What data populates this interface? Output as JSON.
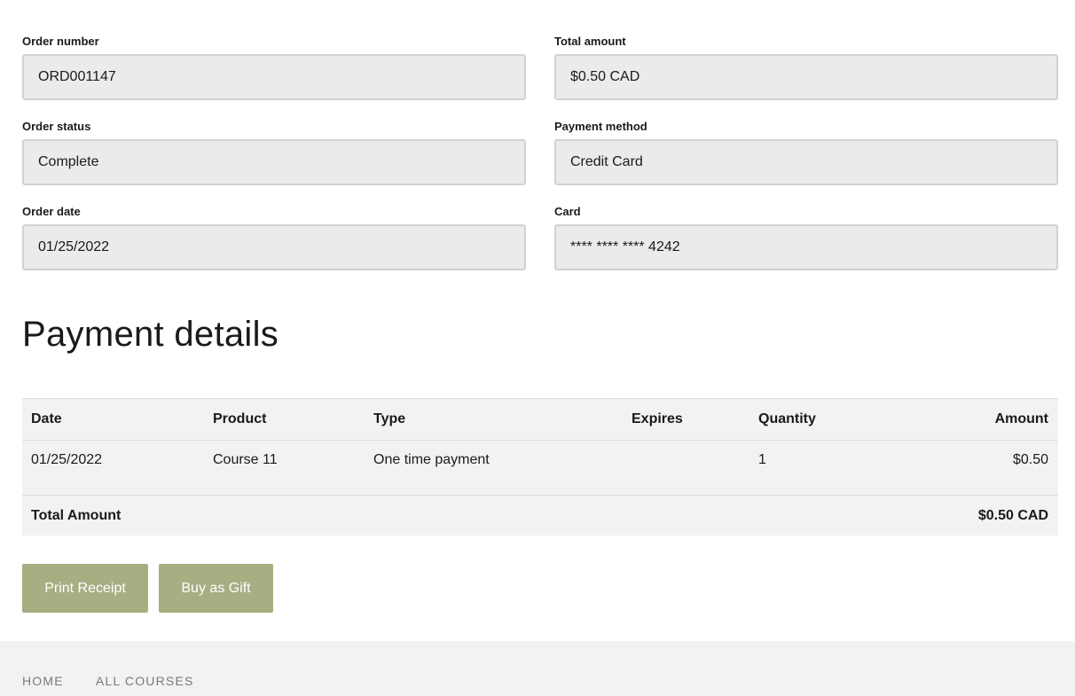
{
  "order": {
    "number_label": "Order number",
    "number": "ORD001147",
    "total_label": "Total amount",
    "total": "$0.50 CAD",
    "status_label": "Order status",
    "status": "Complete",
    "payment_method_label": "Payment method",
    "payment_method": "Credit Card",
    "date_label": "Order date",
    "date": "01/25/2022",
    "card_label": "Card",
    "card": "**** **** **** 4242"
  },
  "payment_details": {
    "title": "Payment details",
    "columns": {
      "date": "Date",
      "product": "Product",
      "type": "Type",
      "expires": "Expires",
      "quantity": "Quantity",
      "amount": "Amount"
    },
    "rows": [
      {
        "date": "01/25/2022",
        "product": "Course 11",
        "type": "One time payment",
        "expires": "",
        "quantity": "1",
        "amount": "$0.50"
      }
    ],
    "total_label": "Total Amount",
    "total_value": "$0.50 CAD"
  },
  "actions": {
    "print_label": "Print Receipt",
    "gift_label": "Buy as Gift"
  },
  "footer": {
    "links": [
      "HOME",
      "ALL COURSES"
    ]
  },
  "colors": {
    "button": "#a9ad82",
    "input_bg": "#ebebeb",
    "table_bg": "#f2f2f2",
    "footer_bg": "#f2f2f2"
  }
}
